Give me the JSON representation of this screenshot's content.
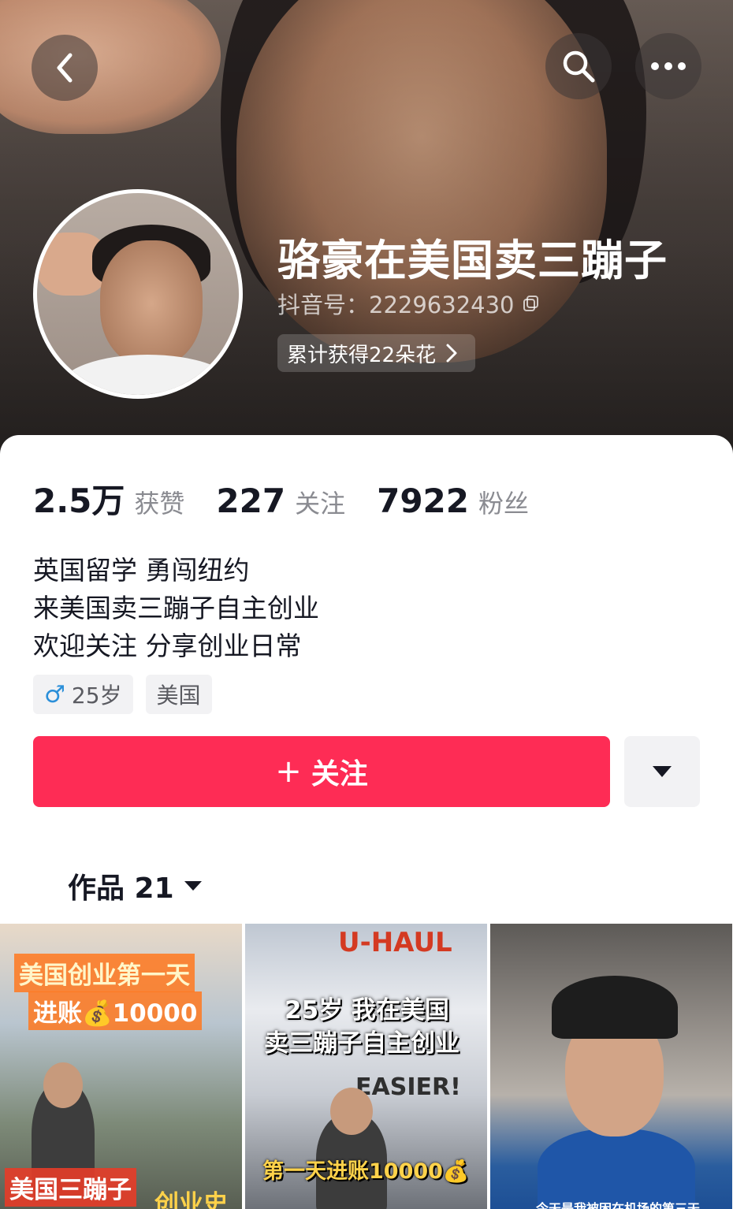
{
  "header": {
    "name": "骆豪在美国卖三蹦子",
    "douyin_id": "抖音号：2229632430",
    "flowers": "累计获得22朵花",
    "icons": {
      "back": "back-chevron-icon",
      "search": "search-icon",
      "more": "more-dots-icon",
      "copy": "copy-icon",
      "chevron": "chevron-right-icon"
    }
  },
  "stats": [
    {
      "value": "2.5万",
      "label": "获赞"
    },
    {
      "value": "227",
      "label": "关注"
    },
    {
      "value": "7922",
      "label": "粉丝"
    }
  ],
  "bio": {
    "line1": "英国留学 勇闯纽约",
    "line2": "来美国卖三蹦子自主创业",
    "line3": "欢迎关注 分享创业日常"
  },
  "tags": {
    "gender_symbol": "♂",
    "age": "25岁",
    "location": "美国"
  },
  "actions": {
    "follow_plus": "+",
    "follow_label": "关注"
  },
  "works": {
    "label": "作品 21"
  },
  "videos": [
    {
      "overlay_line1": "美国创业第一天",
      "overlay_line2": "进账💰10000",
      "overlay_line3": "美国三蹦子",
      "overlay_line4": "创业史"
    },
    {
      "overlay_line1": "25岁 我在美国",
      "overlay_line2": "卖三蹦子自主创业",
      "overlay_line3": "第一天进账10000💰",
      "sign1": "U-HAUL",
      "sign2": "EASIER!"
    },
    {
      "caption": "今天是我被困在机场的第三天"
    }
  ],
  "colors": {
    "accent": "#fe2c55",
    "text_primary": "#161823",
    "text_secondary": "#8a8b91"
  }
}
